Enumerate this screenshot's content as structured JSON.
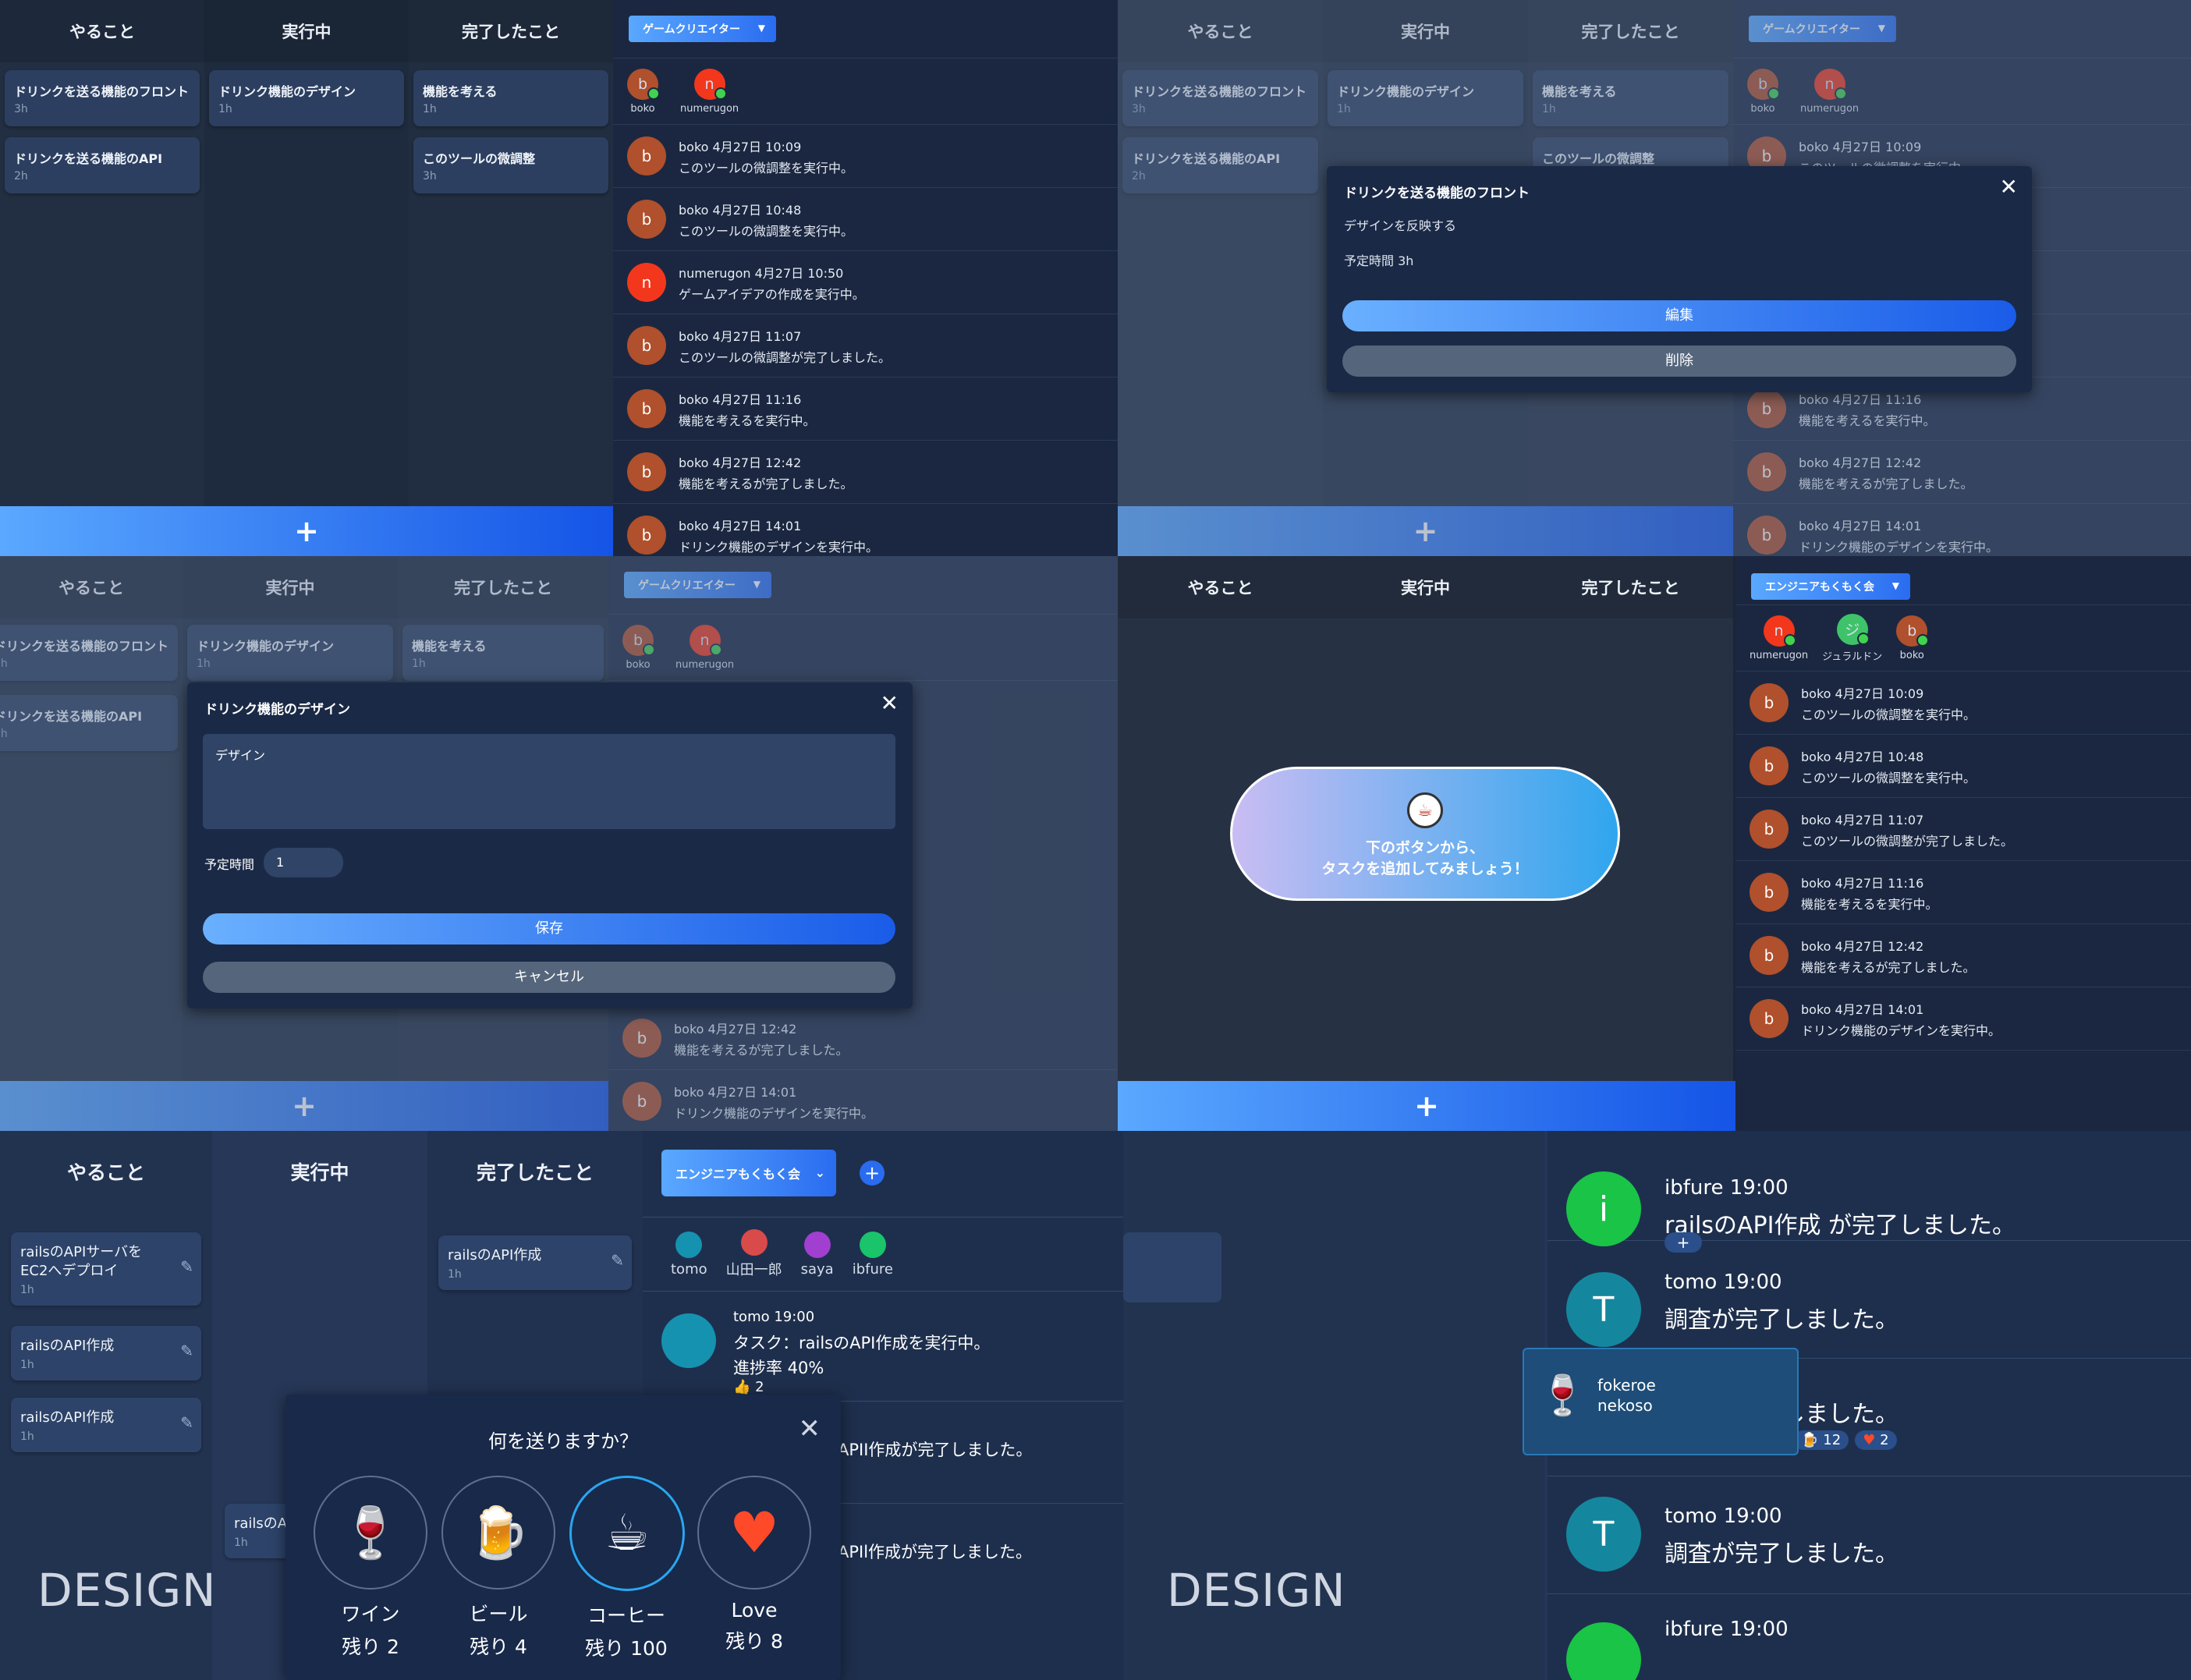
{
  "columns": [
    "やること",
    "実行中",
    "完了したこと"
  ],
  "board": {
    "todo": [
      {
        "title": "ドリンクを送る機能のフロント",
        "hours": "3h"
      },
      {
        "title": "ドリンクを送る機能のAPI",
        "hours": "2h"
      }
    ],
    "doing": [
      {
        "title": "ドリンク機能のデザイン",
        "hours": "1h"
      }
    ],
    "done": [
      {
        "title": "機能を考える",
        "hours": "1h"
      },
      {
        "title": "このツールの微調整",
        "hours": "3h"
      }
    ],
    "add_label": "+"
  },
  "team1": {
    "name": "ゲームクリエイター",
    "members": [
      {
        "name": "boko",
        "initial": "b"
      },
      {
        "name": "numerugon",
        "initial": "n"
      }
    ],
    "feed": [
      {
        "initial": "b",
        "meta": "boko 4月27日 10:09",
        "msg": "このツールの微調整を実行中。"
      },
      {
        "initial": "b",
        "meta": "boko 4月27日 10:48",
        "msg": "このツールの微調整を実行中。"
      },
      {
        "initial": "n",
        "meta": "numerugon 4月27日 10:50",
        "msg": "ゲームアイデアの作成を実行中。"
      },
      {
        "initial": "b",
        "meta": "boko 4月27日 11:07",
        "msg": "このツールの微調整が完了しました。"
      },
      {
        "initial": "b",
        "meta": "boko 4月27日 11:16",
        "msg": "機能を考えるを実行中。"
      },
      {
        "initial": "b",
        "meta": "boko 4月27日 12:42",
        "msg": "機能を考えるが完了しました。"
      },
      {
        "initial": "b",
        "meta": "boko 4月27日 14:01",
        "msg": "ドリンク機能のデザインを実行中。"
      }
    ]
  },
  "modal_detail": {
    "title": "ドリンクを送る機能のフロント",
    "description": "デザインを反映する",
    "estimate": "予定時間 3h",
    "edit": "編集",
    "delete": "削除",
    "close": "✕"
  },
  "modal_edit": {
    "title": "ドリンク機能のデザイン",
    "textarea": "デザイン",
    "estimate_label": "予定時間",
    "estimate_value": "1",
    "save": "保存",
    "cancel": "キャンセル",
    "close": "✕"
  },
  "team2": {
    "name": "エンジニアもくもく会",
    "members": [
      {
        "name": "numerugon",
        "initial": "n"
      },
      {
        "name": "ジュラルドン",
        "initial": "ジ"
      },
      {
        "name": "boko",
        "initial": "b"
      }
    ],
    "feed": [
      {
        "initial": "b",
        "meta": "boko 4月27日 10:09",
        "msg": "このツールの微調整を実行中。"
      },
      {
        "initial": "b",
        "meta": "boko 4月27日 10:48",
        "msg": "このツールの微調整を実行中。"
      },
      {
        "initial": "b",
        "meta": "boko 4月27日 11:07",
        "msg": "このツールの微調整が完了しました。"
      },
      {
        "initial": "b",
        "meta": "boko 4月27日 11:16",
        "msg": "機能を考えるを実行中。"
      },
      {
        "initial": "b",
        "meta": "boko 4月27日 12:42",
        "msg": "機能を考えるが完了しました。"
      },
      {
        "initial": "b",
        "meta": "boko 4月27日 14:01",
        "msg": "ドリンク機能のデザインを実行中。"
      }
    ],
    "empty_line1": "下のボタンから、",
    "empty_line2": "タスクを追加してみましょう！"
  },
  "design_board": {
    "todo": [
      {
        "title": "railsのAPIサーバをEC2へデプロイ",
        "hours": "1h"
      },
      {
        "title": "railsのAPI作成",
        "hours": "1h"
      },
      {
        "title": "railsのAPI作成",
        "hours": "1h"
      }
    ],
    "doing": [
      {
        "title": "railsのA",
        "hours": "1h"
      }
    ],
    "done": [
      {
        "title": "railsのAPI作成",
        "hours": "1h"
      }
    ],
    "team": "エンジニアもくもく会",
    "members": [
      "tomo",
      "山田一郎",
      "saya",
      "ibfure"
    ],
    "post_author": "tomo 19:00",
    "post_line1": "タスク：railsのAPI作成を実行中。",
    "post_line2": "進捗率 40%",
    "post_likes": "2",
    "post_frag1": "APII作成が完了しました。",
    "post_frag2": "APIl作成が完了しました。",
    "design_label": "DESIGN"
  },
  "drink_modal": {
    "title": "何を送りますか？",
    "close": "✕",
    "options": [
      {
        "label": "ワイン",
        "remain": "残り 2"
      },
      {
        "label": "ビール",
        "remain": "残り 4"
      },
      {
        "label": "コーヒー",
        "remain": "残り 100"
      },
      {
        "label": "Love",
        "remain": "残り 8"
      }
    ]
  },
  "zoom_feed": {
    "items": [
      {
        "initial": "i",
        "author": "ibfure 19:00",
        "msg": "railsのAPI作成 が完了しました。"
      },
      {
        "initial": "T",
        "author": "tomo  19:00",
        "msg": "調査が完了しました。"
      },
      {
        "initial": "T",
        "author": "",
        "msg": "調査が完了しました。"
      },
      {
        "initial": "T",
        "author": "tomo  19:00",
        "msg": "調査が完了しました。"
      },
      {
        "initial": "i",
        "author": "ibfure 19:00",
        "msg": ""
      }
    ],
    "reactions": [
      "+",
      "🍺",
      "2",
      "12",
      "2"
    ],
    "toast_line1": "fokeroe",
    "toast_line2": "nekoso",
    "design_label": "DESIGN"
  },
  "colors": {
    "accent": "#1a5ce8",
    "accent_light": "#5aa8ff",
    "online": "#41d34f",
    "avatar_b": "#b0502c",
    "avatar_n": "#f2371d"
  }
}
